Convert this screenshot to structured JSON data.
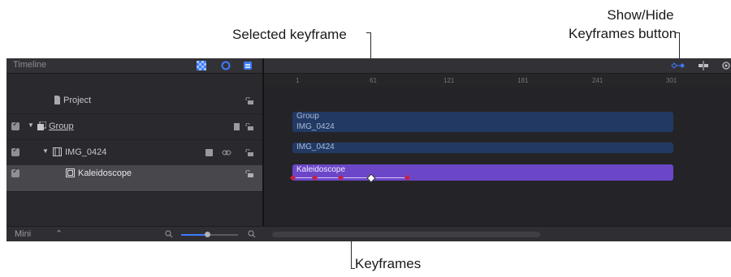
{
  "callouts": {
    "show_hide": [
      "Show/Hide",
      "Keyframes button"
    ],
    "selected_keyframe": "Selected keyframe",
    "keyframes": "Keyframes"
  },
  "timeline": {
    "title": "Timeline",
    "rows": [
      {
        "label": "Project",
        "icon": "document-icon"
      },
      {
        "label": "Group",
        "icon": "group-stack-icon"
      },
      {
        "label": "IMG_0424",
        "icon": "filmstrip-icon"
      },
      {
        "label": "Kaleidoscope",
        "icon": "filter-icon"
      }
    ],
    "footer": {
      "mode": "Mini"
    },
    "ruler_ticks": [
      "1",
      "61",
      "121",
      "181",
      "241",
      "301"
    ],
    "clips": {
      "group_label": "Group",
      "group_sub": "IMG_0424",
      "img": "IMG_0424",
      "kaleido": "Kaleidoscope"
    },
    "keyframe_count": 5
  },
  "colors": {
    "clip_blue": "#2b4b7e",
    "clip_purple": "#6b47c8",
    "keyframe_red": "#c82040",
    "selected_keyframe": "#ffffff",
    "accent_blue": "#3d7bff"
  }
}
